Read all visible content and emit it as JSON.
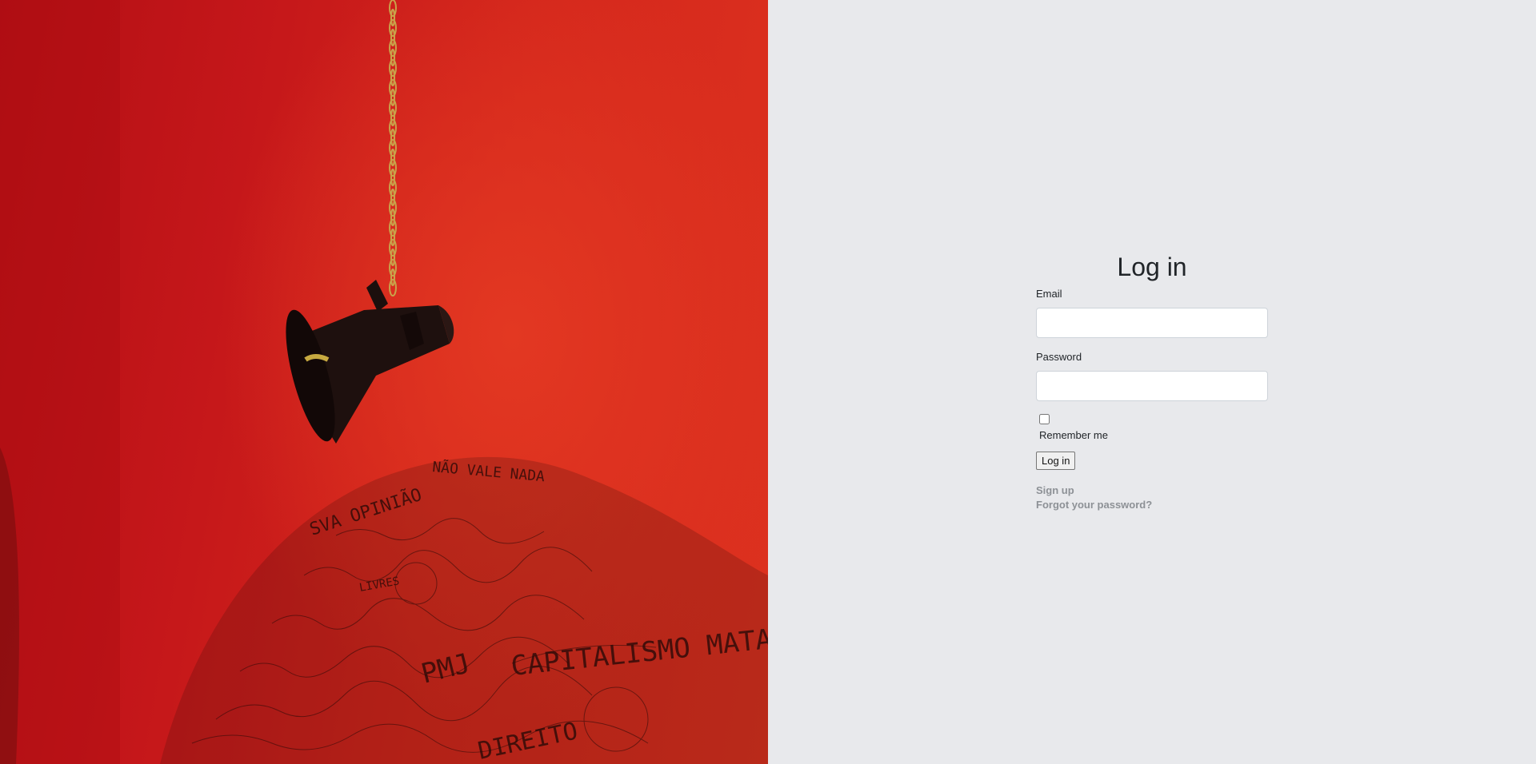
{
  "login": {
    "title": "Log in",
    "email_label": "Email",
    "email_value": "",
    "password_label": "Password",
    "password_value": "",
    "remember_label": "Remember me",
    "remember_checked": false,
    "submit_label": "Log in"
  },
  "links": {
    "sign_up": "Sign up",
    "forgot_password": "Forgot your password?"
  },
  "hero": {
    "wall_texts": [
      "SVA OPINIÃO",
      "NÃO VALE NADA",
      "CAPITALISMO MATA",
      "PMJ",
      "LIVRES",
      "DIREITO"
    ],
    "colors": {
      "wall": "#d4271c",
      "ink": "#2a0a08"
    }
  },
  "theme": {
    "panel_bg": "#e8e9ec",
    "link_color": "#8d9196"
  }
}
